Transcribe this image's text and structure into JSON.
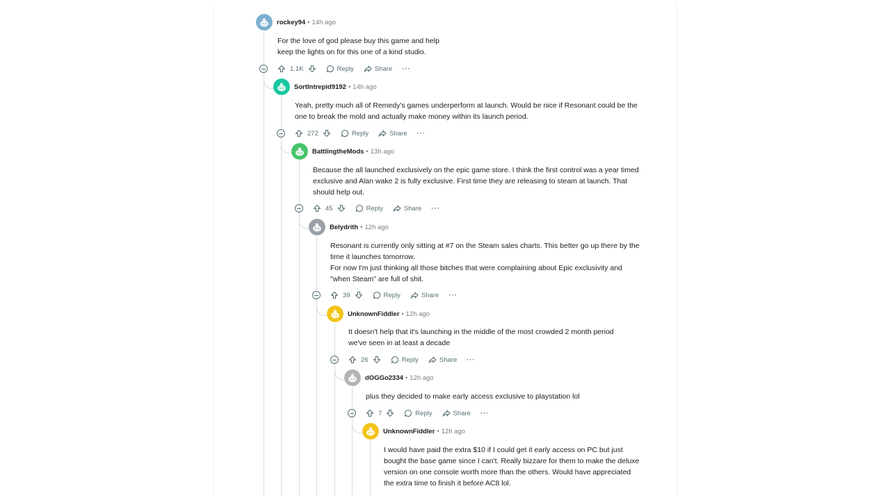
{
  "comments": [
    {
      "author": "rockey94",
      "time": "14h ago",
      "avatar_color": "#7eb0cf",
      "lines": [
        "For the love of god please buy this game and help",
        "keep the lights on for this one of a kind studio."
      ],
      "votes": "1.1K"
    },
    {
      "author": "SortIntrepid9192",
      "time": "14h ago",
      "avatar_color": "#19c8a0",
      "lines": [
        "Yeah, pretty much all of Remedy's games underperform at launch. Would be nice if Resonant could be the",
        "one to break the mold and actually make money within its launch period."
      ],
      "votes": "272"
    },
    {
      "author": "BattlingtheMods",
      "time": "13h ago",
      "avatar_color": "#46c46a",
      "lines": [
        "Because the all launched exclusively on the epic game store. I think the first control was a year timed",
        "exclusive and Alan wake 2 is fully exclusive. First time they are releasing to steam at launch. That",
        "should help out."
      ],
      "votes": "45"
    },
    {
      "author": "Belydrith",
      "time": "12h ago",
      "avatar_color": "#9aa0a6",
      "lines": [
        "Resonant is currently only sitting at #7 on the Steam sales charts. This better go up there by the",
        "time it launches tomorrow.",
        "For now I'm just thinking all those bitches that were complaining about Epic exclusivity and",
        "\"when Steam\" are full of shit."
      ],
      "votes": "39"
    },
    {
      "author": "UnknownFiddler",
      "time": "12h ago",
      "avatar_color": "#f2c417",
      "lines": [
        "It doesn't help that it's launching in the middle of the most crowded 2 month period",
        "we've seen in at least a decade"
      ],
      "votes": "26"
    },
    {
      "author": "dOGGo2334",
      "time": "12h ago",
      "avatar_color": "#b4b4b4",
      "lines": [
        "plus they decided to make early access exclusive to playstation lol"
      ],
      "votes": "7"
    },
    {
      "author": "UnknownFiddler",
      "time": "12h ago",
      "avatar_color": "#f2c417",
      "lines": [
        "I would have paid the extra $10 if I could get it early access on PC but just",
        "bought the base game since I can't. Really bizzare for them to make the deluxe",
        "version on one console worth more than the others. Would have appreciated",
        "the extra time to finish it before AC8 lol."
      ],
      "votes": ""
    }
  ],
  "labels": {
    "reply": "Reply",
    "share": "Share",
    "more": "···",
    "separator": "•"
  },
  "icons": [
    "upvote-icon",
    "downvote-icon",
    "reply-icon",
    "share-icon",
    "collapse-icon",
    "more-icon"
  ]
}
